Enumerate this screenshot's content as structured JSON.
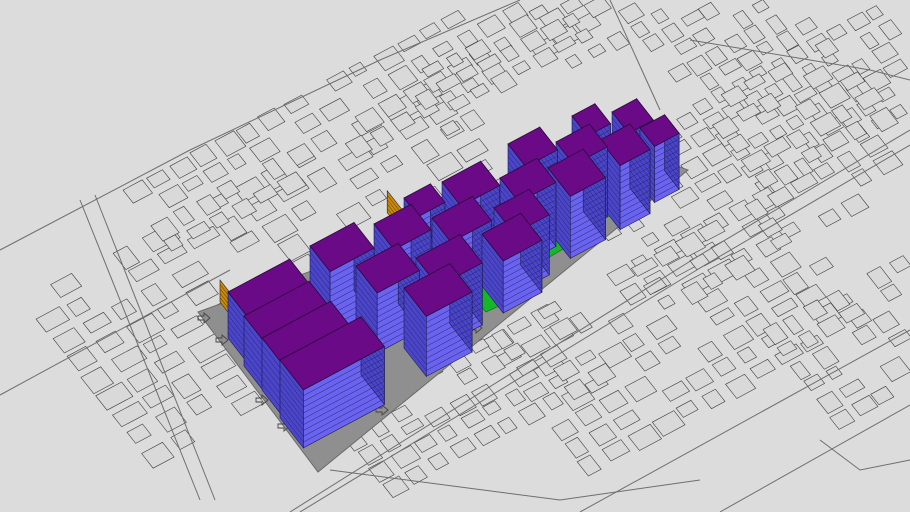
{
  "scene": {
    "background_color": "#dcdcdc",
    "site_color": "#8f8f8f",
    "roof_color": "#6b0a86",
    "facade_color": "#6a63f0",
    "facade_shade_color": "#4b45c9",
    "podium_color": "#f2b321",
    "podium_shade_color": "#c98b08",
    "green_color": "#17b52a",
    "context_line_color": "#3e3e3e"
  },
  "site": {
    "towers_visible": 22,
    "entrance_markers": 7,
    "green_courtyards": 8
  },
  "icons": [
    "entry-arrow-icon"
  ]
}
